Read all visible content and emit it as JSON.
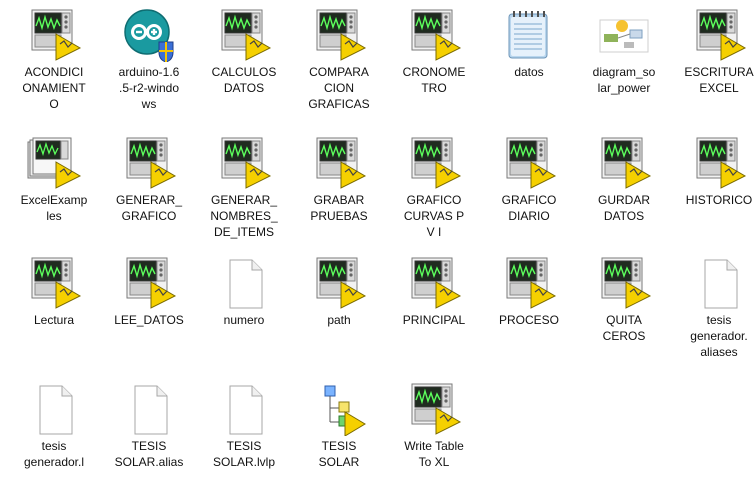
{
  "window": {
    "title": "Explorer file view"
  },
  "files": [
    {
      "label": "ACONDICI\nONAMIENT\nO",
      "icon": "labview-vi-icon"
    },
    {
      "label": "arduino-1.6\n.5-r2-windo\nws",
      "icon": "arduino-installer-icon"
    },
    {
      "label": "CALCULOS\nDATOS",
      "icon": "labview-vi-icon"
    },
    {
      "label": "COMPARA\nCION\nGRAFICAS",
      "icon": "labview-vi-icon"
    },
    {
      "label": "CRONOME\nTRO",
      "icon": "labview-vi-icon"
    },
    {
      "label": "datos",
      "icon": "notepad-text-icon"
    },
    {
      "label": "diagram_so\nlar_power",
      "icon": "image-file-icon"
    },
    {
      "label": "ESCRITURA\nEXCEL",
      "icon": "labview-vi-icon"
    },
    {
      "label": "ExcelExamp\nles",
      "icon": "labview-library-icon"
    },
    {
      "label": "GENERAR_\nGRAFICO",
      "icon": "labview-vi-icon"
    },
    {
      "label": "GENERAR_\nNOMBRES_\nDE_ITEMS",
      "icon": "labview-vi-icon"
    },
    {
      "label": "GRABAR\nPRUEBAS",
      "icon": "labview-vi-icon"
    },
    {
      "label": "GRAFICO\nCURVAS P\nV I",
      "icon": "labview-vi-icon"
    },
    {
      "label": "GRAFICO\nDIARIO",
      "icon": "labview-vi-icon"
    },
    {
      "label": "GURDAR\nDATOS",
      "icon": "labview-vi-icon"
    },
    {
      "label": "HISTORICO",
      "icon": "labview-vi-icon"
    },
    {
      "label": "Lectura",
      "icon": "labview-vi-icon"
    },
    {
      "label": "LEE_DATOS",
      "icon": "labview-vi-icon"
    },
    {
      "label": "numero",
      "icon": "blank-file-icon"
    },
    {
      "label": "path",
      "icon": "labview-vi-icon"
    },
    {
      "label": "PRINCIPAL",
      "icon": "labview-vi-icon"
    },
    {
      "label": "PROCESO",
      "icon": "labview-vi-icon"
    },
    {
      "label": "QUITA\nCEROS",
      "icon": "labview-vi-icon"
    },
    {
      "label": "tesis\ngenerador.\naliases",
      "icon": "blank-file-icon"
    },
    {
      "label": "tesis\ngenerador.l",
      "icon": "blank-file-icon"
    },
    {
      "label": "TESIS\nSOLAR.alias",
      "icon": "blank-file-icon"
    },
    {
      "label": "TESIS\nSOLAR.lvlp",
      "icon": "blank-file-icon"
    },
    {
      "label": "TESIS\nSOLAR",
      "icon": "labview-project-icon"
    },
    {
      "label": "Write Table\nTo XL",
      "icon": "labview-vi-icon"
    }
  ]
}
